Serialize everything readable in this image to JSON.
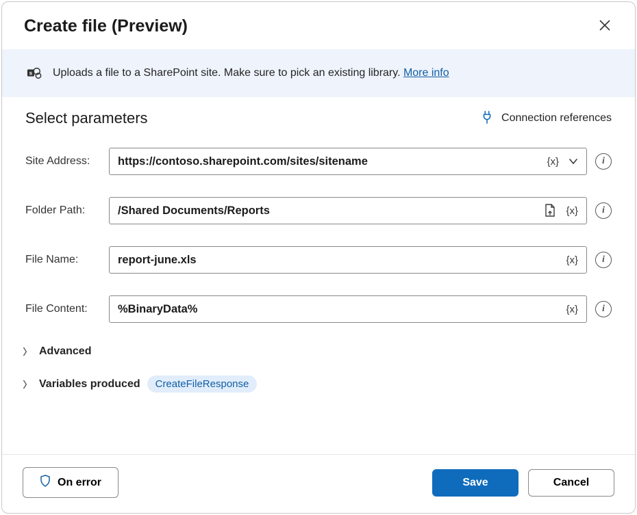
{
  "header": {
    "title": "Create file (Preview)"
  },
  "banner": {
    "text": "Uploads a file to a SharePoint site. Make sure to pick an existing library. ",
    "link_text": "More info"
  },
  "params": {
    "title": "Select parameters",
    "conn_refs_label": "Connection references",
    "fields": {
      "site_address": {
        "label": "Site Address:",
        "value": "https://contoso.sharepoint.com/sites/sitename"
      },
      "folder_path": {
        "label": "Folder Path:",
        "value": "/Shared Documents/Reports"
      },
      "file_name": {
        "label": "File Name:",
        "value": "report-june.xls"
      },
      "file_content": {
        "label": "File Content:",
        "value": "%BinaryData%"
      }
    },
    "var_token": "{x}"
  },
  "expanders": {
    "advanced_label": "Advanced",
    "variables_produced_label": "Variables produced",
    "variables_badge": "CreateFileResponse"
  },
  "footer": {
    "on_error": "On error",
    "save": "Save",
    "cancel": "Cancel"
  }
}
